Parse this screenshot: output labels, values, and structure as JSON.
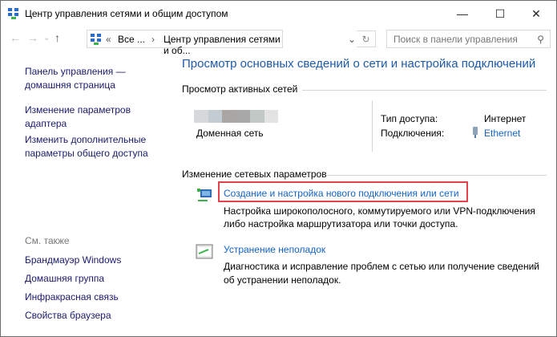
{
  "window": {
    "title": "Центр управления сетями и общим доступом",
    "minimize": "—",
    "maximize": "☐",
    "close": "✕"
  },
  "nav": {
    "back": "←",
    "forward": "→",
    "recent": "⌄",
    "up": "↑"
  },
  "address": {
    "prefix": "«",
    "root": "Все ...",
    "sep": "›",
    "current": "Центр управления сетями и об...",
    "dropdown": "⌄",
    "refresh": "↻"
  },
  "search": {
    "placeholder": "Поиск в панели управления",
    "icon": "⚲"
  },
  "sidebar": {
    "home": [
      "Панель управления —",
      "домашняя страница"
    ],
    "adapter": [
      "Изменение параметров",
      "адаптера"
    ],
    "sharing": [
      "Изменить дополнительные",
      "параметры общего доступа"
    ],
    "see_also": "См. также",
    "links": [
      "Брандмауэр Windows",
      "Домашняя группа",
      "Инфракрасная связь",
      "Свойства браузера"
    ]
  },
  "main": {
    "heading": "Просмотр основных сведений о сети и настройка подключений",
    "active_title": "Просмотр активных сетей",
    "network_type": "Доменная сеть",
    "access_label": "Тип доступа:",
    "access_value": "Интернет",
    "conn_label": "Подключения:",
    "conn_value": "Ethernet",
    "change_title": "Изменение сетевых параметров",
    "tasks": [
      {
        "link": "Создание и настройка нового подключения или сети",
        "desc": [
          "Настройка широкополосного, коммутируемого или VPN-подключения",
          "либо настройка маршрутизатора или точки доступа."
        ]
      },
      {
        "link": "Устранение неполадок",
        "desc": [
          "Диагностика и исправление проблем с сетью или получение сведений",
          "об устранении неполадок."
        ]
      }
    ]
  },
  "colors": {
    "link": "#1464c8",
    "heading": "#1e5aa8",
    "highlight": "#e3444c"
  }
}
